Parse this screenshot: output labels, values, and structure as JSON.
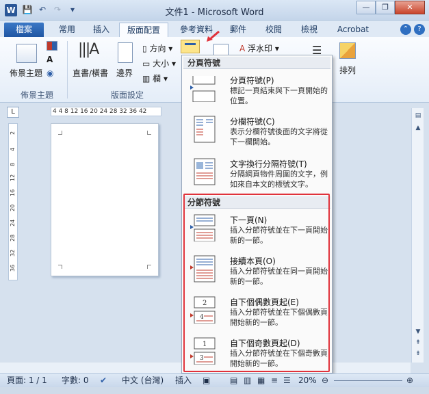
{
  "window": {
    "app_icon": "W",
    "title": "文件1 - Microsoft Word",
    "min_label": "—",
    "max_label": "❐",
    "close_label": "✕"
  },
  "tabs": [
    {
      "label": "檔案"
    },
    {
      "label": "常用"
    },
    {
      "label": "插入"
    },
    {
      "label": "版面配置"
    },
    {
      "label": "參考資料"
    },
    {
      "label": "郵件"
    },
    {
      "label": "校閱"
    },
    {
      "label": "檢視"
    },
    {
      "label": "Acrobat"
    }
  ],
  "ribbon": {
    "theme_label": "佈景主題",
    "theme_group": "佈景主題",
    "direction_label": "直書/橫書",
    "margins_label": "邊界",
    "orientation_label": "方向",
    "size_label": "大小",
    "columns_label": "欄",
    "page_setup_group": "版面設定",
    "watermark_label": "浮水印",
    "arrange_label": "排列"
  },
  "menu": {
    "page_breaks_header": "分頁符號",
    "section_breaks_header": "分節符號",
    "items": [
      {
        "title": "分頁符號(P)",
        "desc": "標記一頁結束與下一頁開始的位置。"
      },
      {
        "title": "分欄符號(C)",
        "desc": "表示分欄符號後面的文字將從下一欄開始。"
      },
      {
        "title": "文字換行分隔符號(T)",
        "desc": "分隔網頁物件周圍的文字，例如來自本文的標號文字。"
      },
      {
        "title": "下一頁(N)",
        "desc": "插入分節符號並在下一頁開始新的一節。"
      },
      {
        "title": "接續本頁(O)",
        "desc": "插入分節符號並在同一頁開始新的一節。"
      },
      {
        "title": "自下個偶數頁起(E)",
        "desc": "插入分節符號並在下個偶數頁開始新的一節。"
      },
      {
        "title": "自下個奇數頁起(D)",
        "desc": "插入分節符號並在下個奇數頁開始新的一節。"
      }
    ]
  },
  "ruler": {
    "h_ticks": "4  4  8  12 16 20 24 28 32 36  42",
    "v_ticks": [
      "2",
      "4",
      "8",
      "12",
      "16",
      "20",
      "24",
      "28",
      "32",
      "36"
    ]
  },
  "status": {
    "page": "頁面: 1 / 1",
    "words": "字數: 0",
    "language": "中文 (台灣)",
    "mode": "插入",
    "zoom": "20%"
  },
  "colors": {
    "accent": "#2b5797",
    "highlight_border": "#e0323b"
  }
}
